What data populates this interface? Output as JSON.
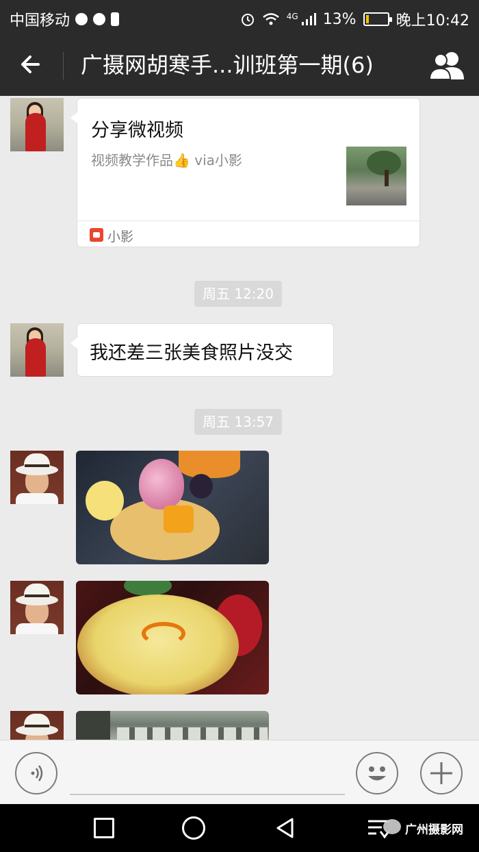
{
  "status_bar": {
    "carrier": "中国移动",
    "network": "4G",
    "battery": "13%",
    "battery_level": 0.13,
    "time": "晚上10:42"
  },
  "header": {
    "title": "广摄网胡寒手...训班第一期(6)",
    "back_icon": "back-arrow-icon",
    "members_icon": "group-members-icon"
  },
  "messages": [
    {
      "type": "share-card",
      "sender": "female-member",
      "title": "分享微视频",
      "desc": "视频教学作品👍 via小影",
      "source": "小影"
    },
    {
      "type": "time",
      "text": "周五 12:20"
    },
    {
      "type": "text",
      "sender": "female-member",
      "text": "我还差三张美食照片没交"
    },
    {
      "type": "time",
      "text": "周五 13:57"
    },
    {
      "type": "image",
      "sender": "male-member",
      "subject": "fruit tart with meringue"
    },
    {
      "type": "image",
      "sender": "male-member",
      "subject": "egg custard tart with orange zest"
    },
    {
      "type": "image",
      "sender": "male-member",
      "subject": "street with parked cars"
    }
  ],
  "input_bar": {
    "voice_icon": "voice-input-icon",
    "emoji_icon": "emoji-icon",
    "plus_icon": "plus-icon"
  },
  "nav_bar": {
    "recent_icon": "recent-apps-icon",
    "home_icon": "home-icon",
    "back_icon": "nav-back-icon",
    "watermark": "广州摄影网"
  },
  "colors": {
    "bar_bg": "#2b2b2b",
    "chat_bg": "#ebebeb",
    "bubble_bg": "#ffffff",
    "time_badge_bg": "#d9d9d9",
    "battery_fill": "#f5c400",
    "source_icon": "#e8472e"
  }
}
